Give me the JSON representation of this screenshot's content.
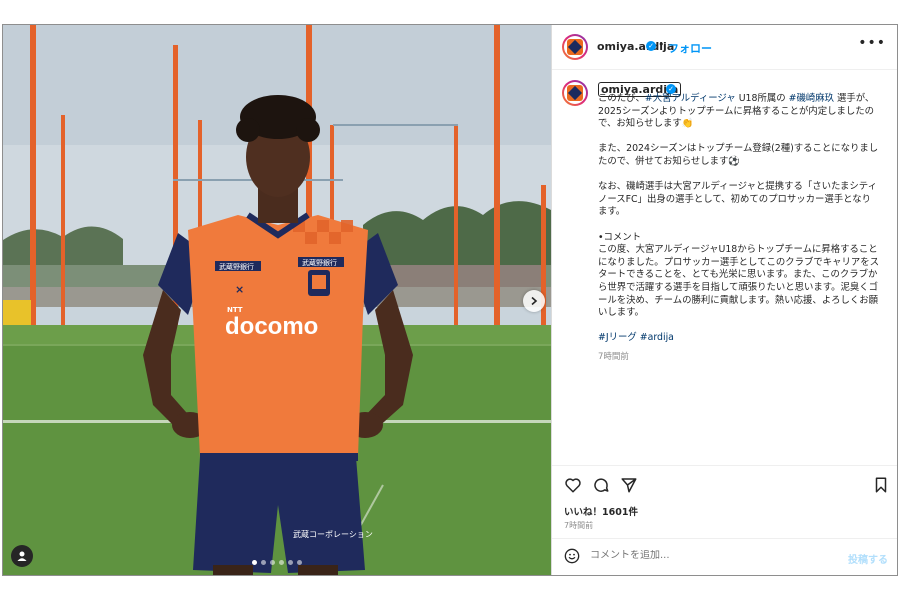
{
  "account": {
    "username": "omiya.ardija",
    "follow_label": "フォロー",
    "separator": "•",
    "more_label": "•••"
  },
  "caption": {
    "username": "omiya.ardija",
    "para1": [
      "このたび、",
      "#大宮アルディージャ",
      " U18所属の ",
      "#磯崎麻玖",
      " 選手が、2025シーズンよりトップチームに昇格することが内定しましたので、お知らせします👏"
    ],
    "para2": "また、2024シーズンはトップチーム登録(2種)することになりましたので、併せてお知らせします⚽",
    "para3": "なお、磯崎選手は大宮アルディージャと提携する「さいたまシティノースFC」出身の選手として、初めてのプロサッカー選手となります。",
    "comment_heading": "•コメント",
    "para4": "この度、大宮アルディージャU18からトップチームに昇格することになりました。プロサッカー選手としてこのクラブでキャリアをスタートできることを、とても光栄に思います。また、このクラブから世界で活躍する選手を目指して頑張りたいと思います。泥臭くゴールを決め、チームの勝利に貢献します。熱い応援、よろしくお願いします。",
    "hashtags": [
      "#Jリーグ",
      "#ardija"
    ],
    "time": "7時間前"
  },
  "photo": {
    "jersey_sponsor": "docomo",
    "jersey_sponsor_small": "NTT",
    "jersey_left_chest": "武蔵野銀行",
    "jersey_right_chest": "武蔵野銀行",
    "shorts_text": "武蔵コーポレーション",
    "carousel_count": 6
  },
  "engagement": {
    "likes": "いいね！1601件",
    "time": "7時間前"
  },
  "comment": {
    "placeholder": "コメントを追加...",
    "post_label": "投稿する"
  },
  "colors": {
    "accent": "#0095f6",
    "hashtag": "#00376b",
    "jersey_orange": "#f07a3c",
    "jersey_navy": "#1f2a5c"
  }
}
